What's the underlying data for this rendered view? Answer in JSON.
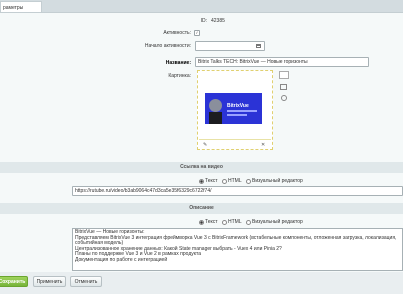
{
  "tab": {
    "label": "раметры"
  },
  "form": {
    "id_label": "ID:",
    "id_value": "42385",
    "active_label": "Активность:",
    "start_label": "Начало активности:",
    "name_label": "Название:",
    "name_value": "Bitrix Talks TECH: BitrixVue — Новые горизонты",
    "picture_label": "Картинка:",
    "thumb_text": "BitrixVue"
  },
  "video_section": {
    "title": "Ссылка на видео",
    "url": "https://rutube.ru/video/b3ab9064c47d3ca5e35f6329c6722f74/"
  },
  "desc_section": {
    "title": "Описание",
    "lines": [
      "BitrixVue — Новые горизонты:",
      "Представляем BitrixVue 3 интеграция фреймворка Vue 3 с BitrixFramework (встабельные компоненты, отложенная загрузка, локализация, событийная модель)",
      "Централизованное хранение данных: Какой State manager выбрать - Vuex 4 или Pinia 2?",
      "Планы по поддержке Vue 3 и Vue 2 в рамках продукта",
      "Документация по работе с интеграцией"
    ]
  },
  "editor_modes": {
    "text": "Текст",
    "html": "HTML",
    "visual": "Визуальный редактор"
  },
  "buttons": {
    "save": "Сохранить",
    "apply": "Применить",
    "cancel": "Отменить"
  },
  "colors": {
    "accent_green": "#77b43a",
    "thumb_blue": "#2b33d6"
  }
}
